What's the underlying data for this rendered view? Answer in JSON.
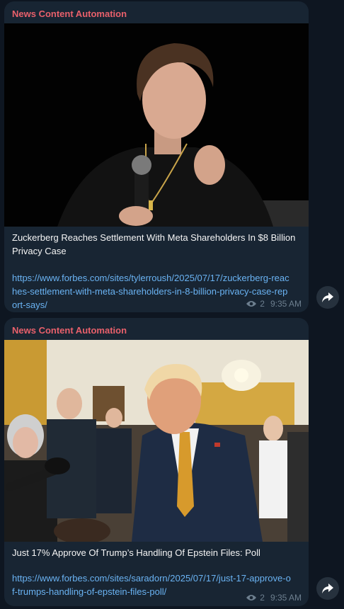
{
  "messages": [
    {
      "sender": "News Content Automation",
      "image_alt": "Man in black t-shirt speaking into a microphone",
      "headline": "Zuckerberg Reaches Settlement With Meta Shareholders In $8 Billion Privacy Case",
      "link": "https://www.forbes.com/sites/tylerroush/2025/07/17/zuckerberg-reaches-settlement-with-meta-shareholders-in-8-billion-privacy-case-report-says/",
      "views": "2",
      "time": "9:35 AM"
    },
    {
      "sender": "News Content Automation",
      "image_alt": "Man in dark suit and gold tie speaking to press at a crowded event",
      "headline": "Just 17% Approve Of Trump’s Handling Of Epstein Files: Poll",
      "link": "https://www.forbes.com/sites/saradorn/2025/07/17/just-17-approve-of-trumps-handling-of-epstein-files-poll/",
      "views": "2",
      "time": "9:35 AM"
    }
  ],
  "icons": {
    "views": "eye-icon",
    "share": "share-arrow-icon"
  },
  "colors": {
    "background": "#0e1621",
    "bubble": "#182533",
    "sender": "#e8606b",
    "link": "#6ab3f3",
    "meta": "#6d7f8f"
  }
}
